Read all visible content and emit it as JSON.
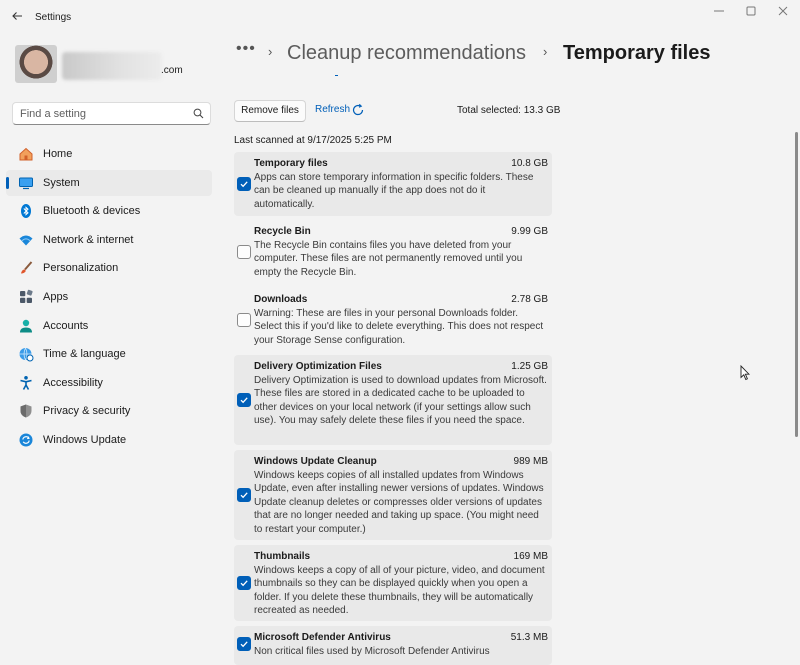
{
  "window": {
    "title": "Settings",
    "back_icon": "back-arrow-icon",
    "controls": [
      "minimize-icon",
      "maximize-icon",
      "close-icon"
    ]
  },
  "profile": {
    "email_suffix": ".com"
  },
  "search": {
    "placeholder": "Find a setting",
    "icon": "search-icon"
  },
  "sidebar": {
    "items": [
      {
        "label": "Home",
        "icon": "home-icon",
        "color": "#e8762b"
      },
      {
        "label": "System",
        "icon": "monitor-icon",
        "color": "#0078d4",
        "active": true
      },
      {
        "label": "Bluetooth & devices",
        "icon": "bluetooth-icon",
        "color": "#0078d4"
      },
      {
        "label": "Network & internet",
        "icon": "wifi-icon",
        "color": "#0078d4"
      },
      {
        "label": "Personalization",
        "icon": "brush-icon",
        "color": "#c24f2b"
      },
      {
        "label": "Apps",
        "icon": "apps-icon",
        "color": "#4a5563"
      },
      {
        "label": "Accounts",
        "icon": "person-icon",
        "color": "#0aa3a3"
      },
      {
        "label": "Time & language",
        "icon": "globe-clock-icon",
        "color": "#0078d4"
      },
      {
        "label": "Accessibility",
        "icon": "accessibility-icon",
        "color": "#0063b1"
      },
      {
        "label": "Privacy & security",
        "icon": "shield-icon",
        "color": "#6b6b6b"
      },
      {
        "label": "Windows Update",
        "icon": "update-icon",
        "color": "#0078d4"
      }
    ]
  },
  "breadcrumb": {
    "overflow": "•••",
    "parent": "Cleanup recommendations",
    "current": "Temporary files",
    "separator": "›"
  },
  "actions": {
    "remove_label": "Remove files",
    "refresh_label": "Refresh",
    "total_selected": "Total selected: 13.3 GB",
    "last_scanned": "Last scanned at 9/17/2025 5:25 PM"
  },
  "files": [
    {
      "name": "Temporary files",
      "size": "10.8 GB",
      "checked": true,
      "description": "Apps can store temporary information in specific folders. These can be cleaned up manually if the app does not do it automatically."
    },
    {
      "name": "Recycle Bin",
      "size": "9.99 GB",
      "checked": false,
      "description": "The Recycle Bin contains files you have deleted from your computer. These files are not permanently removed until you empty the Recycle Bin."
    },
    {
      "name": "Downloads",
      "size": "2.78 GB",
      "checked": false,
      "description": "Warning: These are files in your personal Downloads folder. Select this if you'd like to delete everything. This does not respect your Storage Sense configuration."
    },
    {
      "name": "Delivery Optimization Files",
      "size": "1.25 GB",
      "checked": true,
      "description": "Delivery Optimization is used to download updates from Microsoft. These files are stored in a dedicated cache to be uploaded to other devices on your local network (if your settings allow such use). You may safely delete these files if you need the space."
    },
    {
      "name": "Windows Update Cleanup",
      "size": "989 MB",
      "checked": true,
      "description": "Windows keeps copies of all installed updates from Windows Update, even after installing newer versions of updates. Windows Update cleanup deletes or compresses older versions of updates that are no longer needed and taking up space. (You might need to restart your computer.)"
    },
    {
      "name": "Thumbnails",
      "size": "169 MB",
      "checked": true,
      "description": "Windows keeps a copy of all of your picture, video, and document thumbnails so they can be displayed quickly when you open a folder. If you delete these thumbnails, they will be automatically recreated as needed."
    },
    {
      "name": "Microsoft Defender Antivirus",
      "size": "51.3 MB",
      "checked": true,
      "description": "Non critical files used by Microsoft Defender Antivirus"
    }
  ],
  "colors": {
    "accent": "#005fb8",
    "background": "#f3f3f3",
    "selected_row": "#e9e9e9"
  }
}
